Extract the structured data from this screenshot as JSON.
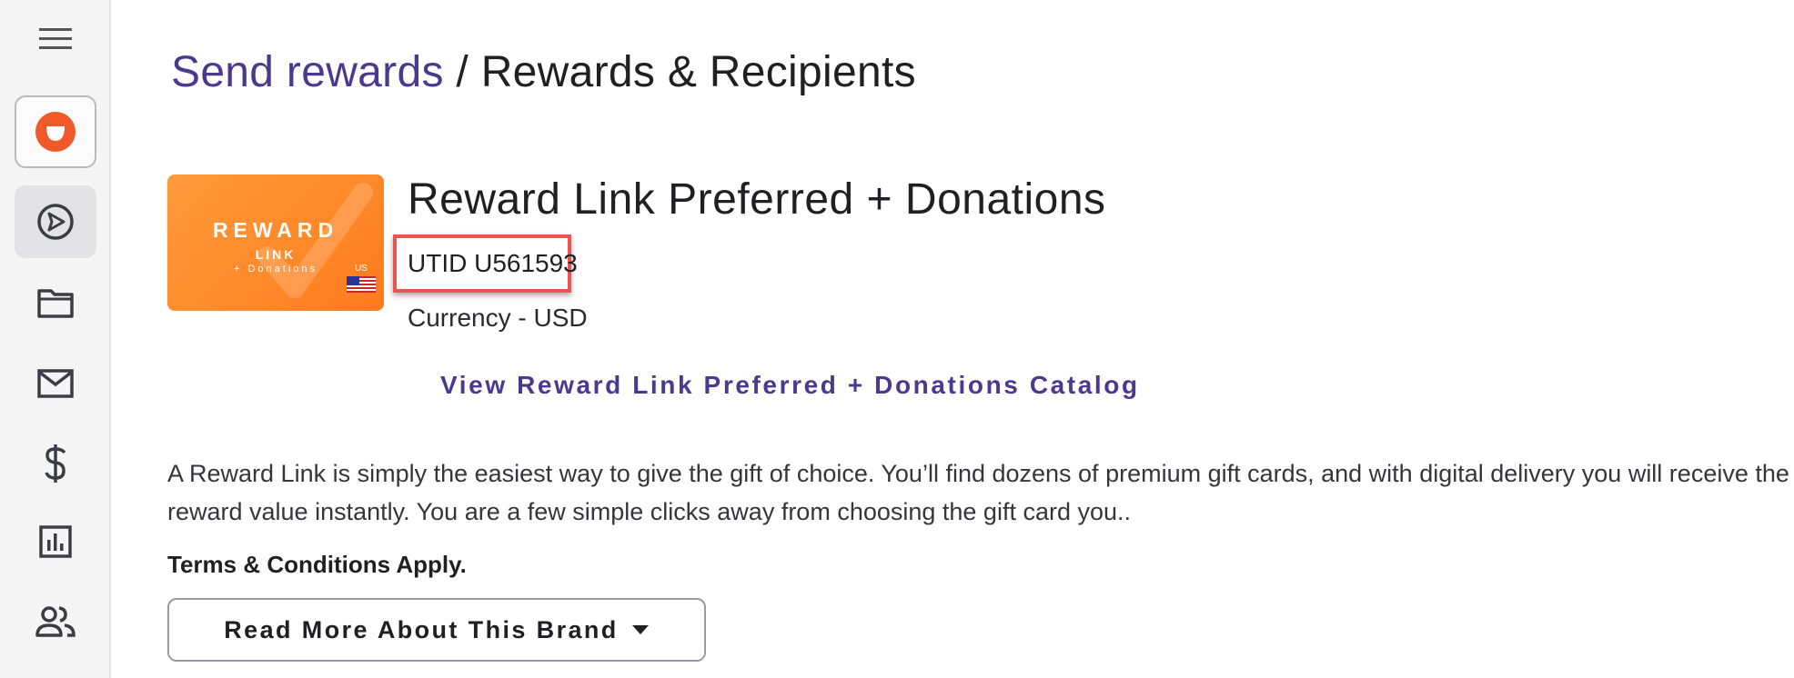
{
  "sidebar": {
    "menu_icon": "hamburger-menu-icon",
    "items": [
      {
        "name": "brand-logo",
        "icon": "smile-logo-icon"
      },
      {
        "name": "send",
        "icon": "send-circle-icon",
        "active": true
      },
      {
        "name": "folder",
        "icon": "folder-icon"
      },
      {
        "name": "email",
        "icon": "mail-icon"
      },
      {
        "name": "funds",
        "icon": "dollar-icon"
      },
      {
        "name": "reports",
        "icon": "bar-chart-icon"
      },
      {
        "name": "people",
        "icon": "people-icon"
      }
    ]
  },
  "breadcrumb": {
    "link": "Send rewards",
    "separator": "/",
    "current": "Rewards & Recipients"
  },
  "card": {
    "title": "REWARD",
    "subtitle": "LINK",
    "subtitle2": "+ Donations",
    "region": "US"
  },
  "product": {
    "title": "Reward Link Preferred + Donations",
    "utid": "UTID U561593",
    "currency": "Currency - USD",
    "catalog_link": "View Reward Link Preferred + Donations Catalog",
    "description": "A Reward Link is simply the easiest way to give the gift of choice. You’ll find dozens of premium gift cards, and with digital delivery you will receive the reward value instantly. You are a few simple clicks away from choosing the gift card you..",
    "terms": "Terms & Conditions Apply.",
    "read_more": "Read More About This Brand"
  },
  "colors": {
    "accent": "#4a3a8f",
    "brand_orange": "#ff8a2a",
    "highlight": "#ef5350"
  }
}
